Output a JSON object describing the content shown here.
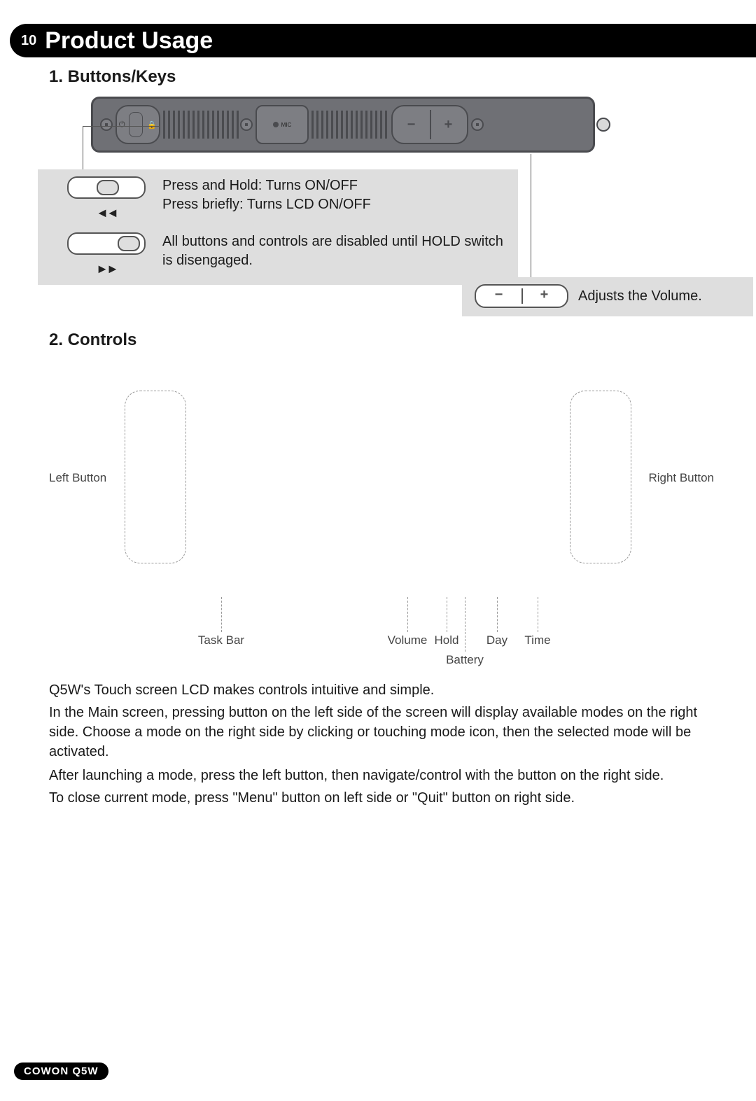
{
  "header": {
    "page_number": "10",
    "title": "Product Usage"
  },
  "section1": {
    "heading": "1. Buttons/Keys",
    "power_callout": {
      "line1": "Press and Hold: Turns ON/OFF",
      "line2": "Press briefly: Turns LCD ON/OFF",
      "arrow_back": "◄◄"
    },
    "hold_callout": {
      "text": "All buttons and controls are disabled until HOLD switch is disengaged.",
      "arrow_fwd": "►►"
    },
    "volume_callout": {
      "minus": "−",
      "plus": "+",
      "text": "Adjusts the Volume."
    },
    "mic_label": "MIC"
  },
  "section2": {
    "heading": "2. Controls",
    "labels": {
      "left": "Left Button",
      "right": "Right Button",
      "taskbar": "Task Bar",
      "volume": "Volume",
      "hold": "Hold",
      "battery": "Battery",
      "day": "Day",
      "time": "Time"
    },
    "paragraphs": {
      "p1": "Q5W's Touch screen LCD makes controls intuitive and simple.",
      "p2": "In the Main screen, pressing button on the left side of the screen will display available modes on the right side.  Choose a mode on the right side by clicking or touching mode icon, then the selected mode will be activated.",
      "p3": "After launching a mode, press the left button, then navigate/control with the button on the right side.",
      "p4": "To close current mode, press \"Menu\" button on left side or \"Quit\" button on right side."
    }
  },
  "footer": {
    "product": "COWON Q5W"
  }
}
